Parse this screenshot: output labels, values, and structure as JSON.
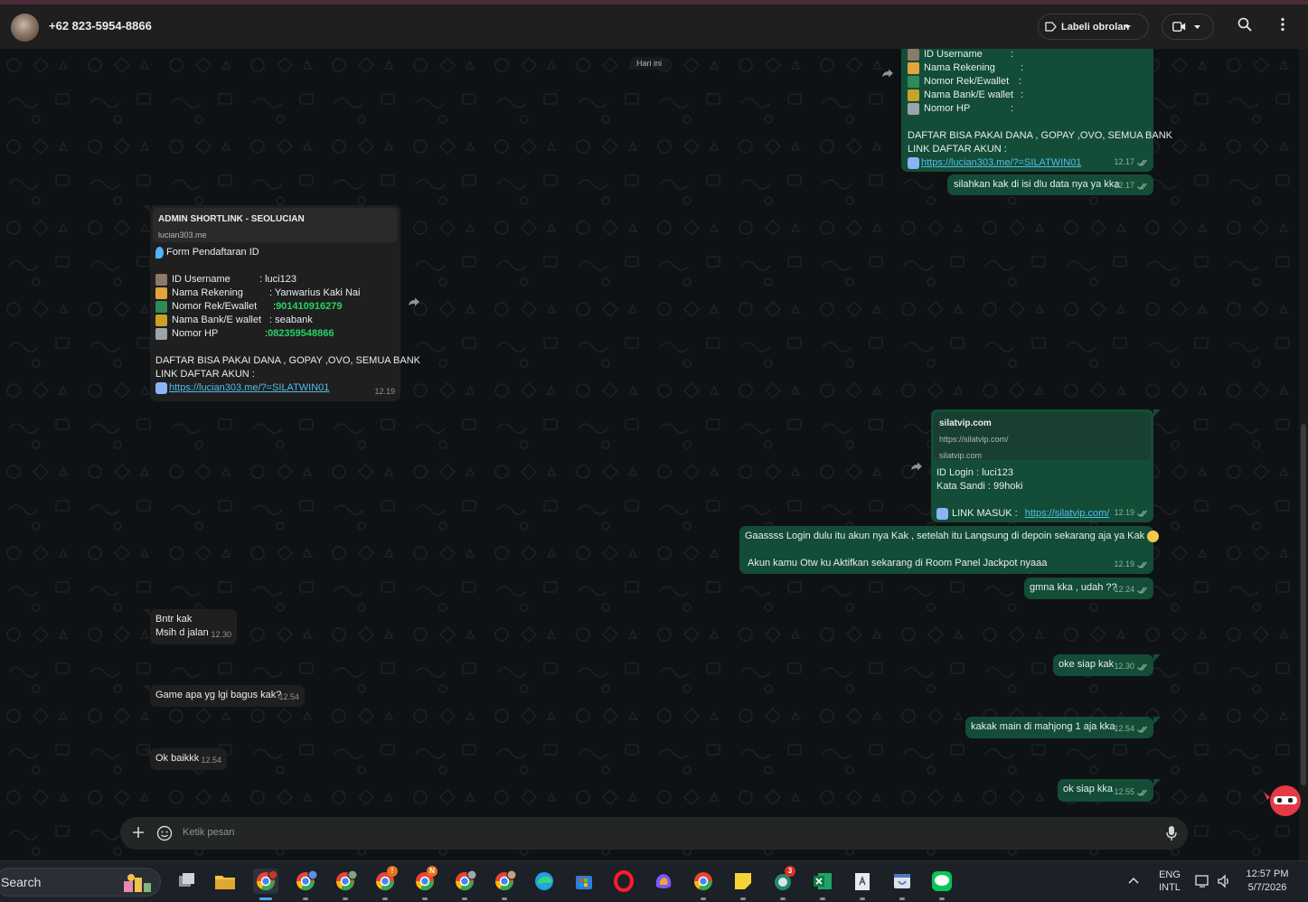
{
  "header": {
    "contact": "+62 823-5954-8866",
    "label_button": "Labeli obrolan"
  },
  "chat": {
    "day_label": "Hari ini",
    "msg_out_form": {
      "lines": [
        "ID Username",
        "Nama Rekening",
        "Nomor Rek/Ewallet",
        "Nama Bank/E wallet",
        "Nomor HP"
      ],
      "colon": ":",
      "daftar1": "DAFTAR BISA PAKAI DANA , GOPAY ,OVO, SEMUA BANK",
      "daftar2": "LINK DAFTAR AKUN :",
      "link": "https://lucian303.me/?=SILATWIN01",
      "time": "12.17"
    },
    "msg_out_isi": {
      "text": "silahkan kak di isi dlu data nya ya kka",
      "time": "12.17"
    },
    "msg_in_form": {
      "preview_title": "ADMIN SHORTLINK - SEOLUCIAN",
      "preview_domain": "lucian303.me",
      "form_title": "Form Pendaftaran ID",
      "rows": [
        {
          "label": "ID Username",
          "value": ": luci123",
          "emoji_color": "#8a7a6a"
        },
        {
          "label": "Nama Rekening",
          "value": ": Yanwarius Kaki Nai",
          "emoji_color": "#e6a23c"
        },
        {
          "label": "Nomor Rek/Ewallet",
          "value": "901410916279",
          "emoji_color": "#2e8b57"
        },
        {
          "label": "Nama Bank/E wallet",
          "value": ": seabank",
          "emoji_color": "#c9a227"
        },
        {
          "label": "Nomor HP",
          "value": "082359548866",
          "emoji_color": "#9aa4ad"
        }
      ],
      "daftar1": "DAFTAR BISA PAKAI DANA , GOPAY ,OVO, SEMUA BANK",
      "daftar2": "LINK DAFTAR AKUN :",
      "link": "https://lucian303.me/?=SILATWIN01",
      "time": "12.19"
    },
    "msg_out_login": {
      "preview_title": "silatvip.com",
      "preview_url": "https://silatvip.com/",
      "preview_domain": "silatvip.com",
      "line1": "ID Login : luci123",
      "line2": "Kata Sandi : 99hoki",
      "link_label": "LINK MASUK  :",
      "link": "https://silatvip.com/",
      "time": "12.19"
    },
    "msg_out_gaass": {
      "line1": "Gaassss Login dulu itu akun nya Kak  , setelah itu Langsung di depoin sekarang aja ya Kak",
      "line2": "Akun kamu Otw ku Aktifkan sekarang di Room Panel Jackpot nyaaa",
      "time": "12.19"
    },
    "msg_out_gmna": {
      "text": "gmna kka , udah ??",
      "time": "12.24"
    },
    "msg_in_bntr": {
      "line1": "Bntr kak",
      "line2": "Msih d jalan",
      "time": "12.30"
    },
    "msg_out_oke": {
      "text": "oke siap kak",
      "time": "12.30"
    },
    "msg_in_game": {
      "text": "Game apa yg lgi bagus kak?",
      "time": "12.54"
    },
    "msg_out_mahjong": {
      "text": "kakak main di mahjong 1 aja kka",
      "time": "12.54"
    },
    "msg_in_ok": {
      "text": "Ok baikkk",
      "time": "12.54"
    },
    "msg_out_ok": {
      "text": "ok siap kka",
      "time": "12.55"
    }
  },
  "composer": {
    "placeholder": "Ketik pesan"
  },
  "taskbar": {
    "search": "Search",
    "lang1": "ENG",
    "lang2": "INTL",
    "time": "12:57 PM",
    "date": "5/7/2026",
    "badges": {
      "chrome4": "!",
      "chrome5": "N",
      "edge_app": "3"
    }
  },
  "colors": {
    "accent_green": "#25d366",
    "bubble_out": "#134d37",
    "bubble_in": "#1f1f1f",
    "link": "#53bdeb"
  }
}
